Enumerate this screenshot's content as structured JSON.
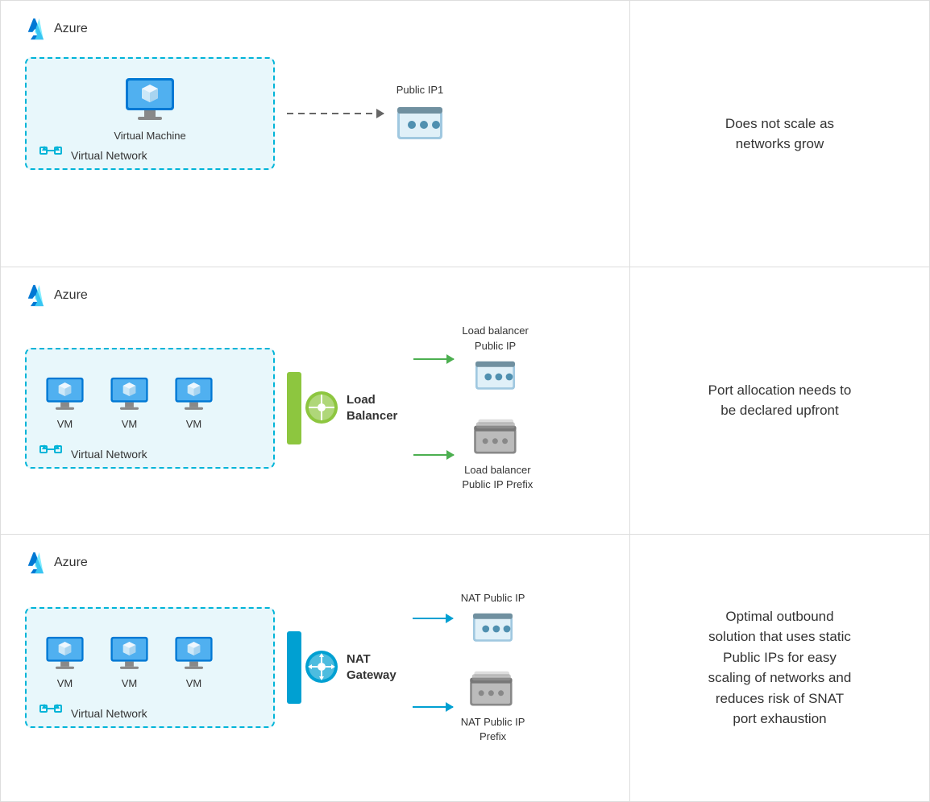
{
  "rows": [
    {
      "id": "row1",
      "azure_label": "Azure",
      "description": "Does not scale as\nnetworks grow",
      "vnet_label": "Virtual Network",
      "vm_label": "Virtual Machine",
      "right_labels": [
        "Public IP1"
      ],
      "arrow_type": "dashed"
    },
    {
      "id": "row2",
      "azure_label": "Azure",
      "description": "Port allocation needs to\nbe declared upfront",
      "vnet_label": "Virtual Network",
      "vm_labels": [
        "VM",
        "VM",
        "VM"
      ],
      "middle_label": "Load\nBalancer",
      "right_labels": [
        "Load balancer\nPublic IP",
        "Load balancer\nPublic IP Prefix"
      ],
      "arrow_type": "green"
    },
    {
      "id": "row3",
      "azure_label": "Azure",
      "description": "Optimal outbound\nsolution that uses static\nPublic IPs for easy\nscaling of networks and\nreduces risk of SNAT\nport exhaustion",
      "vnet_label": "Virtual Network",
      "vm_labels": [
        "VM",
        "VM",
        "VM"
      ],
      "middle_label": "NAT\nGateway",
      "right_labels": [
        "NAT Public IP",
        "NAT Public IP\nPrefix"
      ],
      "arrow_type": "blue"
    }
  ]
}
